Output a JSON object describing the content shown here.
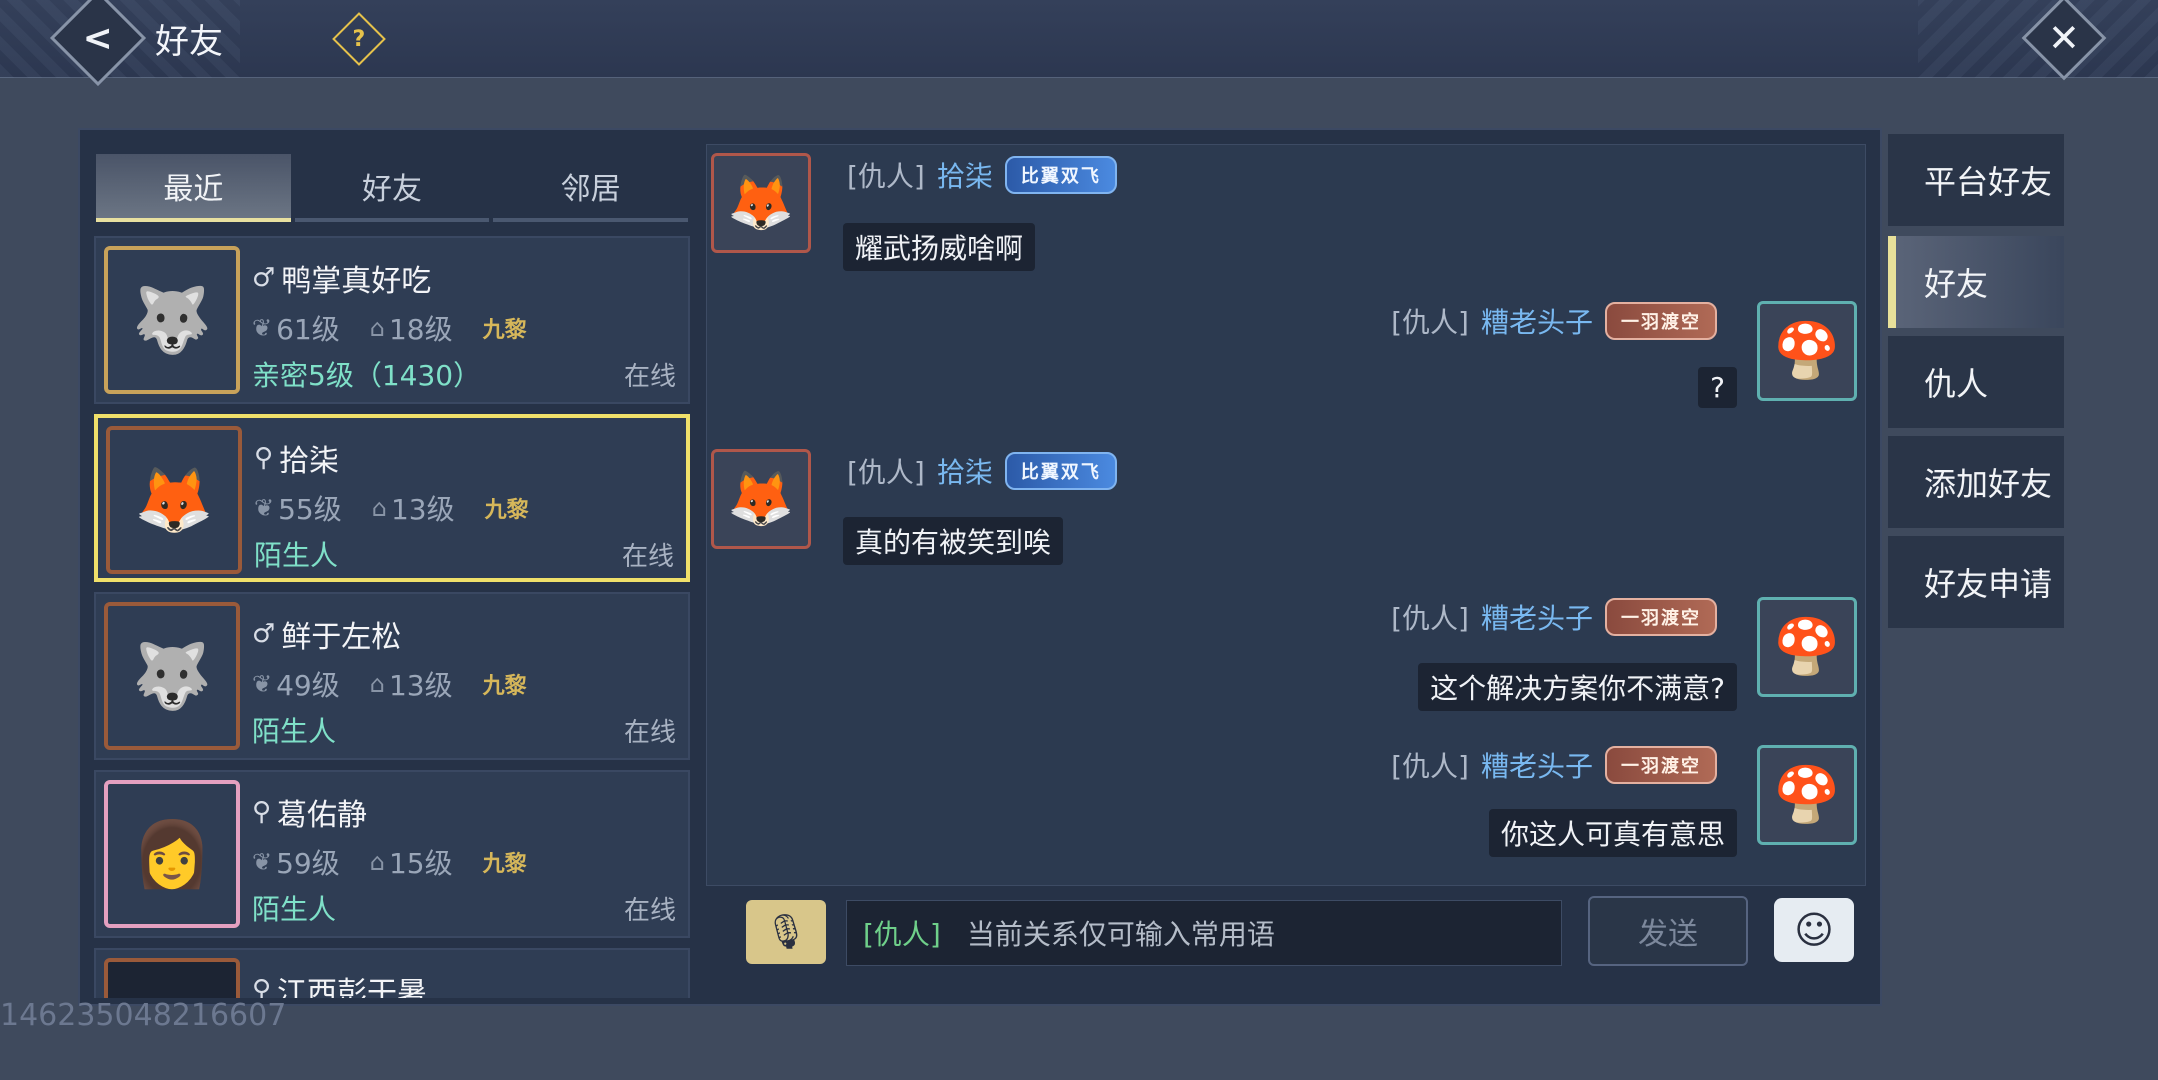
{
  "header": {
    "title": "好友",
    "help_icon": "?",
    "back_icon": "<",
    "close_icon": "✕"
  },
  "left_tabs": [
    {
      "label": "最近",
      "active": true
    },
    {
      "label": "好友",
      "active": false
    },
    {
      "label": "邻居",
      "active": false
    }
  ],
  "contacts": [
    {
      "gender_icon": "♂",
      "name": "鸭掌真好吃",
      "level1": "61级",
      "level2": "18级",
      "guild": "九黎",
      "relation": "亲密5级（1430）",
      "status": "在线",
      "avatar_emoji": "🐺",
      "selected": false
    },
    {
      "gender_icon": "⚲",
      "name": "拾柒",
      "level1": "55级",
      "level2": "13级",
      "guild": "九黎",
      "relation": "陌生人",
      "status": "在线",
      "avatar_emoji": "🦊",
      "selected": true
    },
    {
      "gender_icon": "♂",
      "name": "鲜于左松",
      "level1": "49级",
      "level2": "13级",
      "guild": "九黎",
      "relation": "陌生人",
      "status": "在线",
      "avatar_emoji": "🐺",
      "selected": false
    },
    {
      "gender_icon": "⚲",
      "name": "葛佑静",
      "level1": "59级",
      "level2": "15级",
      "guild": "九黎",
      "relation": "陌生人",
      "status": "在线",
      "avatar_emoji": "👩",
      "selected": false
    },
    {
      "gender_icon": "⚲",
      "name": "江西彭干暑",
      "level1": "",
      "level2": "",
      "guild": "",
      "relation": "",
      "status": "",
      "avatar_emoji": "",
      "selected": false
    }
  ],
  "messages": [
    {
      "side": "left",
      "tag": "[仇人]",
      "sender": "拾柒",
      "badge": "比翼双飞",
      "text": "耀武扬威啥啊"
    },
    {
      "side": "right",
      "tag": "[仇人]",
      "sender": "糟老头子",
      "badge": "一羽渡空",
      "text": "?"
    },
    {
      "side": "left",
      "tag": "[仇人]",
      "sender": "拾柒",
      "badge": "比翼双飞",
      "text": "真的有被笑到唉"
    },
    {
      "side": "right",
      "tag": "[仇人]",
      "sender": "糟老头子",
      "badge": "一羽渡空",
      "text": "这个解决方案你不满意?"
    },
    {
      "side": "right",
      "tag": "[仇人]",
      "sender": "糟老头子",
      "badge": "一羽渡空",
      "text": "你这人可真有意思"
    }
  ],
  "input": {
    "prefix": "[仇人]",
    "placeholder": "当前关系仅可输入常用语",
    "send_label": "发送",
    "voice_icon": "🎙",
    "emoji_icon": "☺"
  },
  "side_tabs": [
    {
      "label": "平台好友",
      "active": false
    },
    {
      "label": "好友",
      "active": true
    },
    {
      "label": "仇人",
      "active": false
    },
    {
      "label": "添加好友",
      "active": false
    },
    {
      "label": "好友申请",
      "active": false
    }
  ],
  "watermark": "14623504821660​7",
  "colors": {
    "accent_yellow": "#f0e06a",
    "relation_teal": "#7fe0c8",
    "sender_blue": "#79b8f0",
    "guild_gold": "#d6b75a"
  }
}
